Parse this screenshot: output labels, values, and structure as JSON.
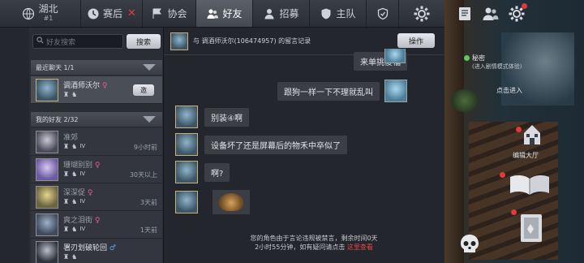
{
  "tabs": {
    "region": {
      "name": "湖北",
      "rank": "#1"
    },
    "post": {
      "label": "赛后"
    },
    "association": {
      "label": "协会"
    },
    "friends": {
      "label": "好友"
    },
    "recruit": {
      "label": "招募"
    },
    "team": {
      "label": "主队"
    }
  },
  "search": {
    "placeholder": "好友搜索",
    "button": "搜索"
  },
  "recent": {
    "header": "最近聊天 1/1",
    "items": [
      {
        "name": "调酒师沃尔",
        "invite": "邀"
      }
    ]
  },
  "my_friends": {
    "header": "我的好友 2/32",
    "items": [
      {
        "name": "准郊",
        "time": "9小时前",
        "level": "IV"
      },
      {
        "name": "珊瑚别别",
        "time": "30天以上",
        "level": "IV"
      },
      {
        "name": "深深促",
        "time": "3天前",
        "level": "IV"
      },
      {
        "name": "爽之泪街",
        "time": "1天前",
        "level": "IV"
      },
      {
        "name": "署刃划破轮回",
        "time": "",
        "level": ""
      }
    ]
  },
  "chat": {
    "header_prefix": "与",
    "header_name": "调酒师沃尔(106474957)",
    "header_suffix": "的留言记录",
    "ops_button": "操作",
    "messages": [
      {
        "from": "me",
        "text": "来单挑傻福"
      },
      {
        "from": "me",
        "text": "跟狗一样一下不理就乱叫"
      },
      {
        "from": "them",
        "text": "别装④啊"
      },
      {
        "from": "them",
        "text": "设备坏了还是屏幕后的物禾中卒似了"
      },
      {
        "from": "them",
        "text": "啊?"
      },
      {
        "from": "them",
        "text": ""
      }
    ],
    "notice_line1": "您的角色由于言论违规被禁言，剩余时间0天",
    "notice_line2": "2小时55分钟，如有疑问请点击",
    "notice_link": "这里查看"
  },
  "scene": {
    "secret_title": "秘密",
    "secret_sub": "(进入剧情模式体验)",
    "enter_label": "点击进入",
    "lobby_label": "编辑大厅"
  },
  "colors": {
    "accent_red": "#e03a3a",
    "button_light": "#e6e8ec",
    "panel_bg": "#2a2d34"
  }
}
